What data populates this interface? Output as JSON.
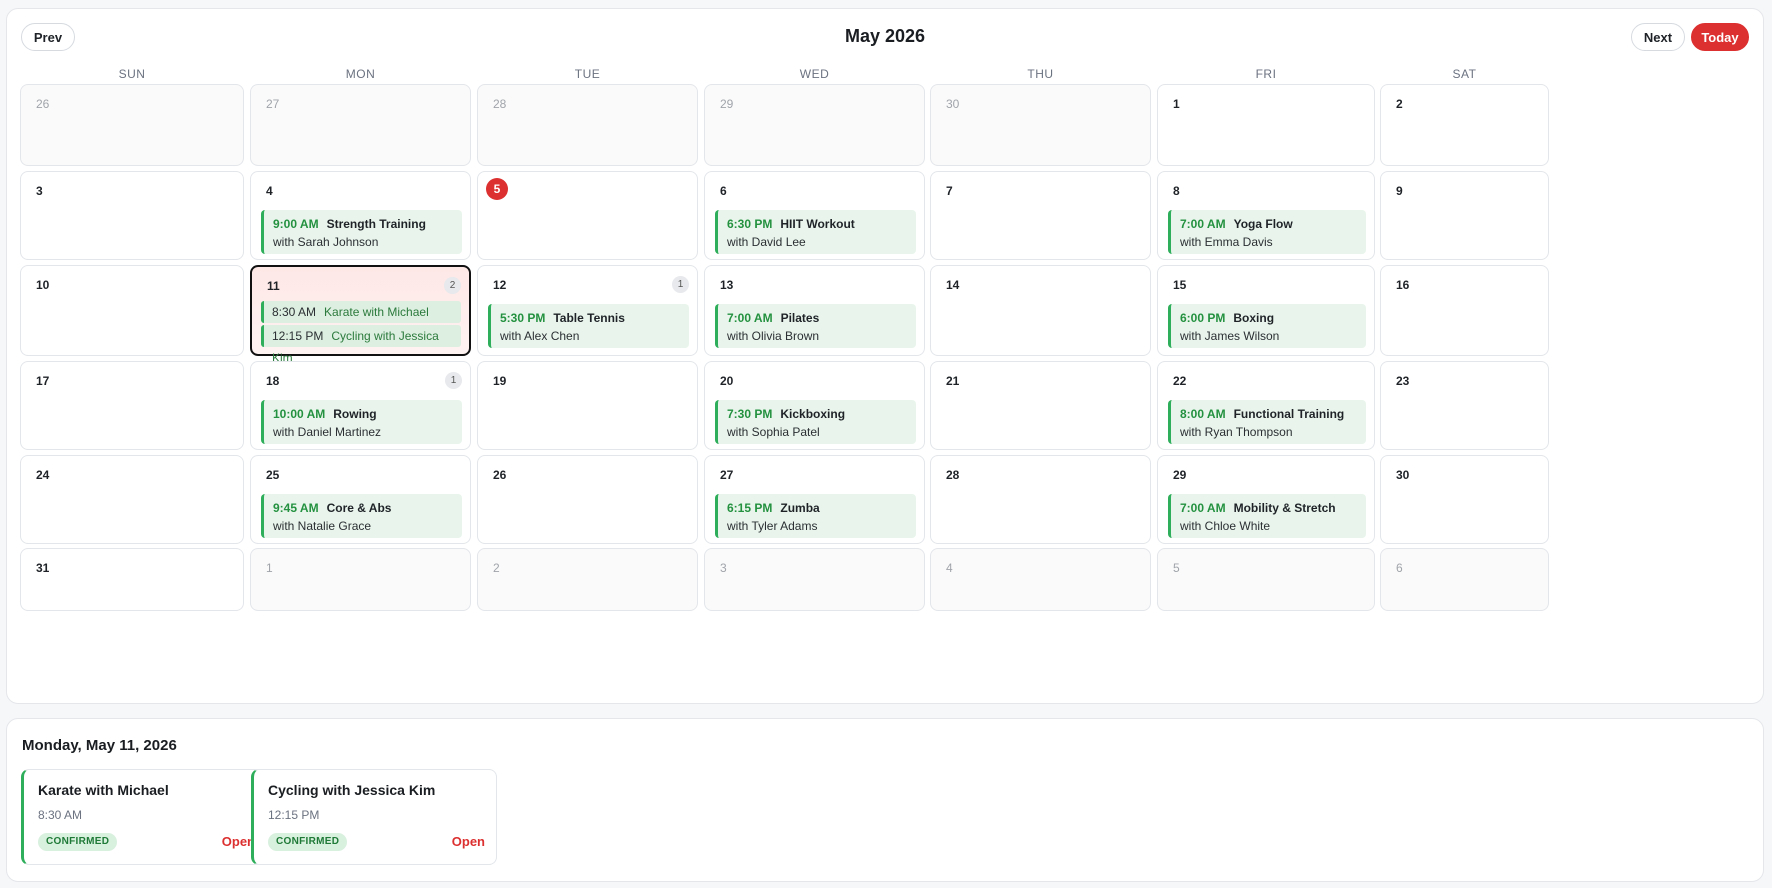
{
  "header": {
    "prev_label": "Prev",
    "next_label": "Next",
    "today_label": "Today",
    "month_title": "May 2026"
  },
  "weekdays": [
    "SUN",
    "MON",
    "TUE",
    "WED",
    "THU",
    "FRI",
    "SAT"
  ],
  "weeks": [
    [
      {
        "day": "26",
        "outside": true
      },
      {
        "day": "27",
        "outside": true
      },
      {
        "day": "28",
        "outside": true
      },
      {
        "day": "29",
        "outside": true
      },
      {
        "day": "30",
        "outside": true
      },
      {
        "day": "1"
      },
      {
        "day": "2"
      }
    ],
    [
      {
        "day": "3"
      },
      {
        "day": "4",
        "event": {
          "time": "9:00 AM",
          "title": "Strength Training",
          "instructor": "with Sarah Johnson"
        }
      },
      {
        "day": "5",
        "today": true
      },
      {
        "day": "6",
        "event": {
          "time": "6:30 PM",
          "title": "HIIT Workout",
          "instructor": "with David Lee"
        }
      },
      {
        "day": "7"
      },
      {
        "day": "8",
        "event": {
          "time": "7:00 AM",
          "title": "Yoga Flow",
          "instructor": "with Emma Davis"
        }
      },
      {
        "day": "9"
      }
    ],
    [
      {
        "day": "10"
      },
      {
        "day": "11",
        "selected": true,
        "count": "2",
        "mini": [
          {
            "time": "8:30 AM",
            "name": "Karate with Michael"
          },
          {
            "time": "12:15 PM",
            "name": "Cycling with Jessica Kim"
          }
        ]
      },
      {
        "day": "12",
        "count": "1",
        "event": {
          "time": "5:30 PM",
          "title": "Table Tennis",
          "instructor": "with Alex Chen"
        }
      },
      {
        "day": "13",
        "event": {
          "time": "7:00 AM",
          "title": "Pilates",
          "instructor": "with Olivia Brown"
        }
      },
      {
        "day": "14"
      },
      {
        "day": "15",
        "event": {
          "time": "6:00 PM",
          "title": "Boxing",
          "instructor": "with James Wilson"
        }
      },
      {
        "day": "16"
      }
    ],
    [
      {
        "day": "17"
      },
      {
        "day": "18",
        "count": "1",
        "event": {
          "time": "10:00 AM",
          "title": "Rowing",
          "instructor": "with Daniel Martinez"
        }
      },
      {
        "day": "19"
      },
      {
        "day": "20",
        "event": {
          "time": "7:30 PM",
          "title": "Kickboxing",
          "instructor": "with Sophia Patel"
        }
      },
      {
        "day": "21"
      },
      {
        "day": "22",
        "event": {
          "time": "8:00 AM",
          "title": "Functional Training",
          "instructor": "with Ryan Thompson"
        }
      },
      {
        "day": "23"
      }
    ],
    [
      {
        "day": "24"
      },
      {
        "day": "25",
        "event": {
          "time": "9:45 AM",
          "title": "Core & Abs",
          "instructor": "with Natalie Grace"
        }
      },
      {
        "day": "26"
      },
      {
        "day": "27",
        "event": {
          "time": "6:15 PM",
          "title": "Zumba",
          "instructor": "with Tyler Adams"
        }
      },
      {
        "day": "28"
      },
      {
        "day": "29",
        "event": {
          "time": "7:00 AM",
          "title": "Mobility & Stretch",
          "instructor": "with Chloe White"
        }
      },
      {
        "day": "30"
      }
    ],
    [
      {
        "day": "31"
      },
      {
        "day": "1",
        "outside": true
      },
      {
        "day": "2",
        "outside": true
      },
      {
        "day": "3",
        "outside": true
      },
      {
        "day": "4",
        "outside": true
      },
      {
        "day": "5",
        "outside": true
      },
      {
        "day": "6",
        "outside": true
      }
    ]
  ],
  "detail": {
    "date_title": "Monday, May 11, 2026",
    "cards": [
      {
        "title": "Karate with Michael",
        "time": "8:30 AM",
        "status": "CONFIRMED",
        "action": "Open"
      },
      {
        "title": "Cycling with Jessica Kim",
        "time": "12:15 PM",
        "status": "CONFIRMED",
        "action": "Open"
      }
    ]
  },
  "colors": {
    "accent_red": "#dc2f2f",
    "event_green": "#2eae5a",
    "event_bg": "#e9f5ec"
  }
}
